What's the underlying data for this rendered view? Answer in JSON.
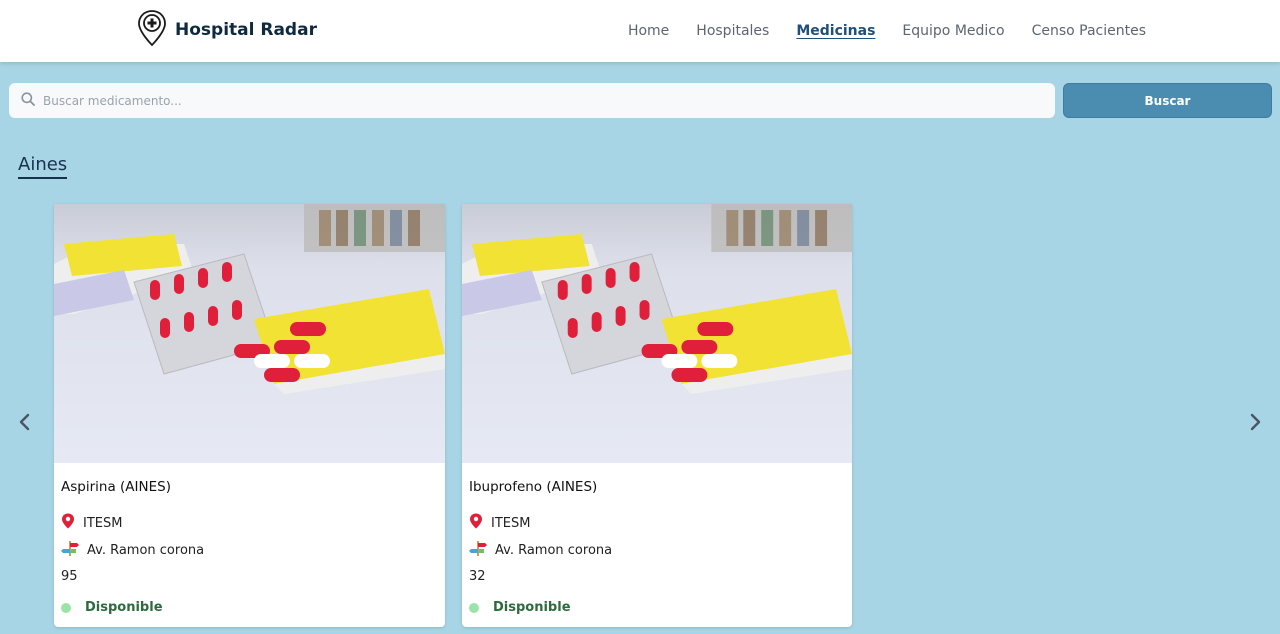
{
  "header": {
    "brand": "Hospital Radar",
    "nav": [
      "Home",
      "Hospitales",
      "Medicinas",
      "Equipo Medico",
      "Censo Pacientes"
    ],
    "active_nav": "Medicinas"
  },
  "search": {
    "placeholder": "Buscar medicamento...",
    "value": "",
    "button_label": "Buscar"
  },
  "section": {
    "title": "Aines"
  },
  "cards": [
    {
      "name": "Aspirina (AINES)",
      "hospital": "ITESM",
      "address": "Av. Ramon corona",
      "quantity": "95",
      "status": "Disponible"
    },
    {
      "name": "Ibuprofeno (AINES)",
      "hospital": "ITESM",
      "address": "Av. Ramon corona",
      "quantity": "32",
      "status": "Disponible"
    }
  ],
  "colors": {
    "background": "#a8d5e5",
    "accent": "#4a8db0",
    "status_available": "#9be3a6",
    "pin": "#e0203a"
  },
  "icons": {
    "logo": "hospital-pin-icon",
    "search": "search-icon",
    "location": "map-pin-icon",
    "address": "signpost-icon",
    "prev": "chevron-left-icon",
    "next": "chevron-right-icon"
  }
}
